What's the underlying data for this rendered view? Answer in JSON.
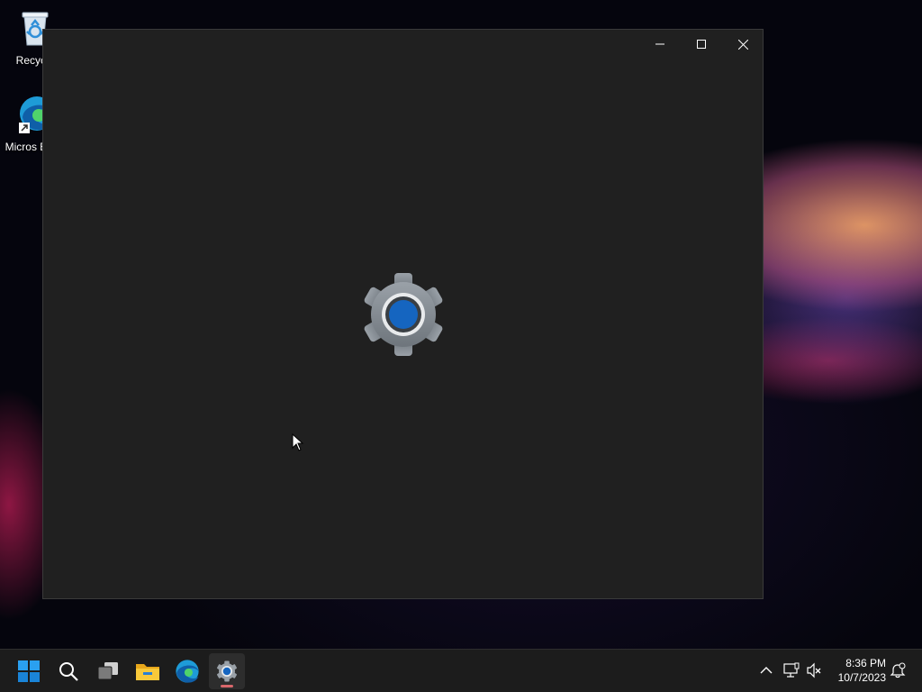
{
  "desktop": {
    "icons": [
      {
        "label": "Recycle",
        "icon": "recycle-bin-icon"
      },
      {
        "label": "Micros Edge",
        "icon": "edge-icon"
      }
    ]
  },
  "window": {
    "app": "Settings",
    "splash_icon": "gear-icon",
    "controls": {
      "minimize": "minimize-icon",
      "maximize": "maximize-icon",
      "close": "close-icon"
    },
    "colors": {
      "background": "#202020",
      "gear_outer": "#8a9096",
      "gear_center": "#1565c0"
    }
  },
  "taskbar": {
    "pinned": [
      {
        "name": "start",
        "icon": "windows-logo-icon"
      },
      {
        "name": "search",
        "icon": "search-icon"
      },
      {
        "name": "task-view",
        "icon": "task-view-icon"
      },
      {
        "name": "file-explorer",
        "icon": "folder-icon"
      },
      {
        "name": "edge",
        "icon": "edge-icon"
      },
      {
        "name": "settings",
        "icon": "gear-icon",
        "active": true
      }
    ],
    "tray": {
      "icons": [
        "chevron-up-icon",
        "network-icon",
        "volume-muted-icon",
        "notification-icon"
      ],
      "time": "8:36 PM",
      "date": "10/7/2023"
    },
    "colors": {
      "accent_indicator": "#d9676b",
      "start_blue": "#0078d4"
    }
  }
}
